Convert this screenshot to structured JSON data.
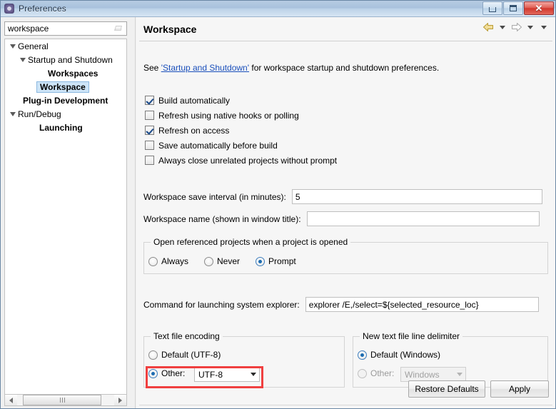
{
  "window": {
    "title": "Preferences",
    "icon": "preferences-gear-icon",
    "buttons": {
      "minimize": "minimize",
      "maximize": "maximize",
      "close": "close"
    }
  },
  "sidebar": {
    "filter": {
      "value": "workspace",
      "placeholder": "type filter text",
      "clear_icon": "eraser-icon"
    },
    "tree": [
      {
        "label": "General",
        "indent": 0,
        "twisty": "expanded",
        "bold": false,
        "selected": false
      },
      {
        "label": "Startup and Shutdown",
        "indent": 1,
        "twisty": "expanded",
        "bold": false,
        "selected": false
      },
      {
        "label": "Workspaces",
        "indent": 2,
        "twisty": "none",
        "bold": true,
        "selected": false
      },
      {
        "label": "Workspace",
        "indent": 1,
        "twisty": "none",
        "bold": true,
        "selected": true
      },
      {
        "label": "Plug-in Development",
        "indent": 0,
        "twisty": "none",
        "bold": true,
        "selected": false
      },
      {
        "label": "Run/Debug",
        "indent": 0,
        "twisty": "expanded",
        "bold": false,
        "selected": false
      },
      {
        "label": "Launching",
        "indent": 1,
        "twisty": "none",
        "bold": true,
        "selected": false
      }
    ],
    "scrollbar": {
      "left_arrow": "scroll-left-arrow",
      "right_arrow": "scroll-right-arrow"
    }
  },
  "page": {
    "title": "Workspace",
    "nav": {
      "back": "back-arrow-icon",
      "back_menu": "back-dropdown-caret",
      "forward": "forward-arrow-icon",
      "forward_menu": "forward-dropdown-caret",
      "view_menu": "view-menu-caret"
    },
    "description": {
      "before": "See ",
      "link": "'Startup and Shutdown'",
      "after": " for workspace startup and shutdown preferences."
    },
    "checkboxes": [
      {
        "label": "Build automatically",
        "checked": true
      },
      {
        "label": "Refresh using native hooks or polling",
        "checked": false
      },
      {
        "label": "Refresh on access",
        "checked": true
      },
      {
        "label": "Save automatically before build",
        "checked": false
      },
      {
        "label": "Always close unrelated projects without prompt",
        "checked": false
      }
    ],
    "save_interval": {
      "label": "Workspace save interval (in minutes):",
      "value": "5"
    },
    "workspace_name": {
      "label": "Workspace name (shown in window title):",
      "value": ""
    },
    "open_referenced": {
      "title": "Open referenced projects when a project is opened",
      "options": [
        {
          "label": "Always",
          "selected": false
        },
        {
          "label": "Never",
          "selected": false
        },
        {
          "label": "Prompt",
          "selected": true
        }
      ]
    },
    "explorer_command": {
      "label": "Command for launching system explorer:",
      "value": "explorer /E,/select=${selected_resource_loc}"
    },
    "text_file_encoding": {
      "title": "Text file encoding",
      "default_option": {
        "label": "Default (UTF-8)",
        "selected": false
      },
      "other_option": {
        "label": "Other:",
        "selected": true
      },
      "combo_value": "UTF-8",
      "highlighted": true
    },
    "line_delimiter": {
      "title": "New text file line delimiter",
      "default_option": {
        "label": "Default (Windows)",
        "selected": true
      },
      "other_option": {
        "label": "Other:",
        "selected": false,
        "disabled": true
      },
      "combo_value": "Windows",
      "combo_disabled": true
    },
    "footer": {
      "restore_defaults": "Restore Defaults",
      "apply": "Apply"
    }
  },
  "colors": {
    "accent_highlight": "#f04040",
    "link": "#1a4fbb",
    "selection": "#cde4f7",
    "close_button": "#d2372c"
  }
}
